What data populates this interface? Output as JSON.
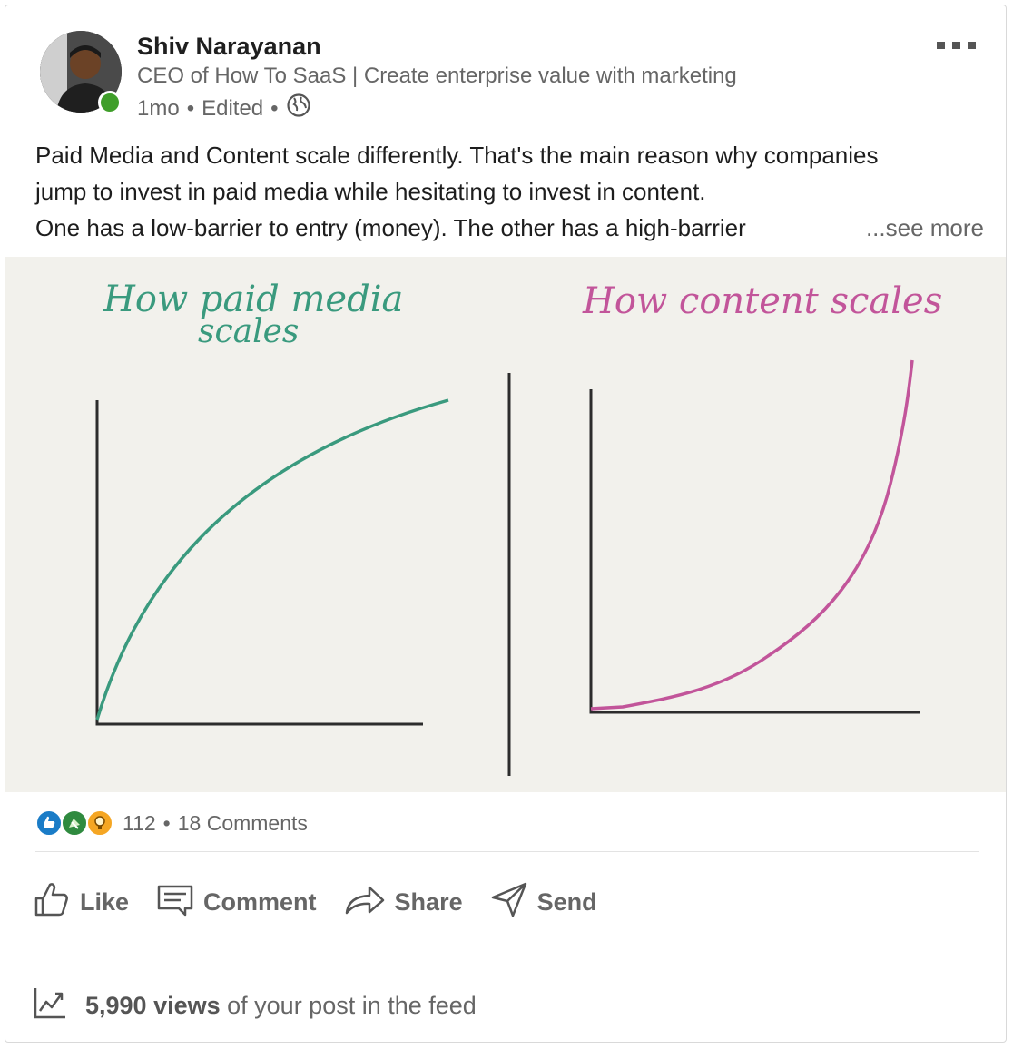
{
  "author": {
    "name": "Shiv Narayanan",
    "headline": "CEO of How To SaaS | Create enterprise value with marketing",
    "time": "1mo",
    "edited": "Edited"
  },
  "post": {
    "line1": "Paid Media and Content scale differently. That's the main reason why companies",
    "line2": "jump to invest in paid media while hesitating to invest in content.",
    "line3": "One has a low-barrier to entry (money). The other has a high-barrier",
    "see_more": "...see more"
  },
  "image": {
    "left_title": "How paid media scales",
    "right_title": "How content scales",
    "left_color": "#3a9a7e",
    "right_color": "#c2559a"
  },
  "social": {
    "reactions_count": "112",
    "comments": "18 Comments"
  },
  "actions": {
    "like": "Like",
    "comment": "Comment",
    "share": "Share",
    "send": "Send"
  },
  "views": {
    "count": "5,990 views",
    "suffix": "of your post in the feed"
  }
}
